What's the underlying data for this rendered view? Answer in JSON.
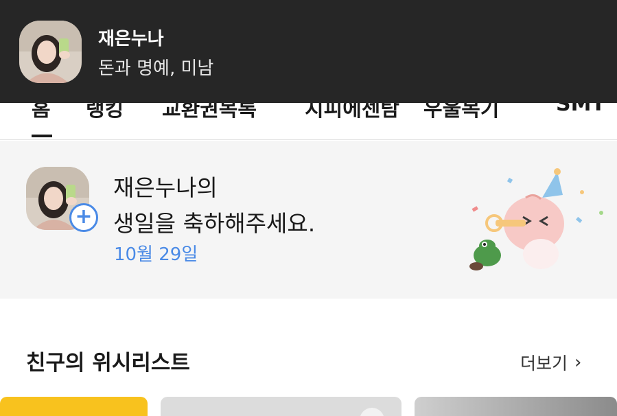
{
  "notification": {
    "sender": "재은누나",
    "message": "돈과 명예, 미남"
  },
  "tabs": [
    {
      "label": "홈"
    },
    {
      "label": "랭킹"
    },
    {
      "label": "교환권목록"
    },
    {
      "label": "지피에센탐"
    },
    {
      "label": "우울목기"
    },
    {
      "label": "SMT"
    }
  ],
  "birthday": {
    "line1": "재은누나의",
    "line2": "생일을 축하해주세요.",
    "date": "10월 29일",
    "add_icon": "plus-icon"
  },
  "wishlist": {
    "title": "친구의 위시리스트",
    "more_label": "더보기",
    "more_icon": "chevron-right-icon"
  },
  "colors": {
    "notification_bg": "#262626",
    "accent_blue": "#4a8ae6",
    "card_bg": "#f5f5f5",
    "yellow": "#f8c21e"
  }
}
